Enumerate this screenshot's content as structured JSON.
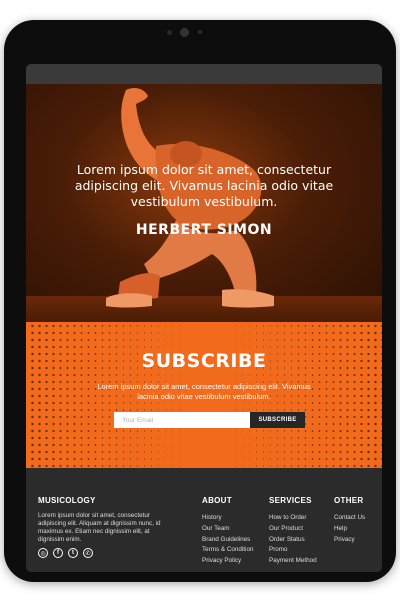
{
  "hero": {
    "quote": "Lorem ipsum dolor sit amet, consectetur adipiscing elit. Vivamus lacinia odio vitae vestibulum vestibulum.",
    "author": "HERBERT SIMON"
  },
  "subscribe": {
    "title": "SUBSCRIBE",
    "text": "Lorem ipsum dolor sit amet, consectetur adipiscing elit. Vivamus lacinia odio vitae vestibulum vestibulum.",
    "email_placeholder": "Your Email",
    "button_label": "SUBSCRIBE"
  },
  "footer": {
    "brand": "MUSICOLOGY",
    "about": "Lorem ipsum dolor sit amet, consectetur adipiscing elit. Aliquam at dignissim nunc, id maximus ex. Etiam nec dignissim elit, at dignissim enim.",
    "social": [
      "instagram-icon",
      "facebook-icon",
      "twitter-icon",
      "whatsapp-icon"
    ],
    "about_col": {
      "title": "ABOUT",
      "items": [
        "History",
        "Our Team",
        "Brand Guidelines",
        "Terms & Condition",
        "Privacy Policy"
      ]
    },
    "services_col": {
      "title": "SERVICES",
      "items": [
        "How to Order",
        "Our Product",
        "Order Status",
        "Promo",
        "Payment Method"
      ]
    },
    "other_col": {
      "title": "OTHER",
      "items": [
        "Contact Us",
        "Help",
        "Privacy"
      ]
    }
  },
  "colors": {
    "accent": "#f26a1b",
    "footer_bg": "#2b2b2b",
    "hero_dark": "#2a1003"
  }
}
